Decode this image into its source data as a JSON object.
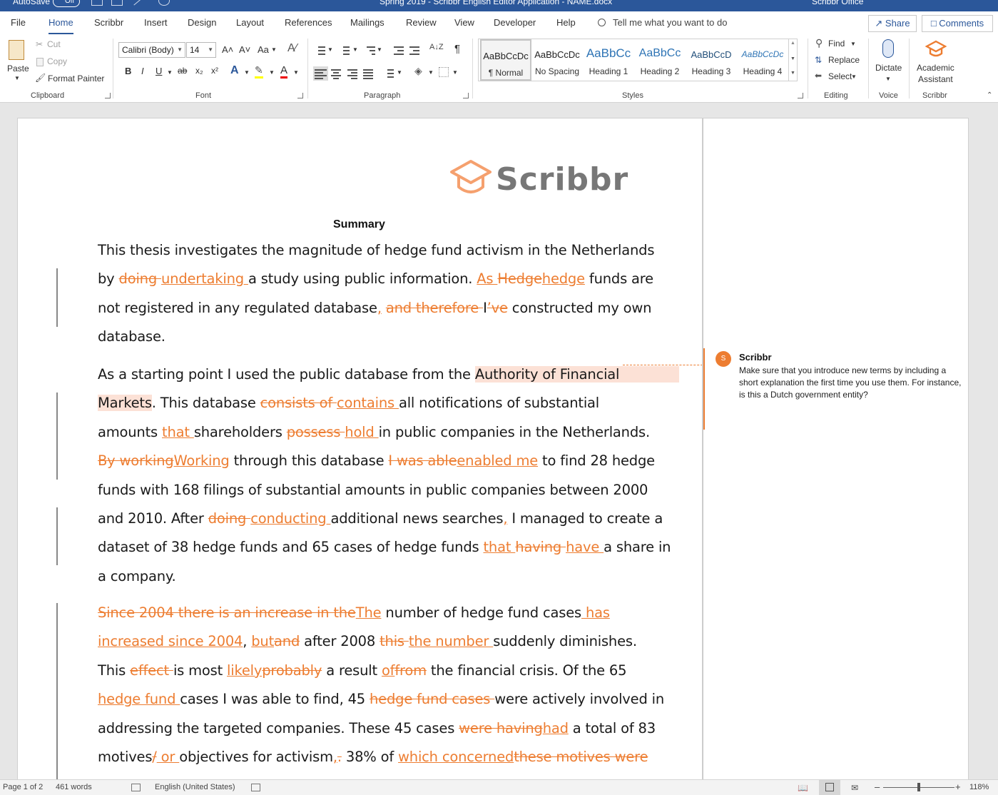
{
  "titlebar": {
    "autosave": "AutoSave",
    "autosave_state": "Off",
    "doc_title": "Spring 2019 - Scribbr English Editor Application - NAME.docx",
    "account": "Scribbr Office"
  },
  "tabs": [
    "File",
    "Home",
    "Scribbr",
    "Insert",
    "Design",
    "Layout",
    "References",
    "Mailings",
    "Review",
    "View",
    "Developer",
    "Help"
  ],
  "tellme": "Tell me what you want to do",
  "share": "Share",
  "comments": "Comments",
  "ribbon": {
    "clipboard": {
      "paste": "Paste",
      "cut": "Cut",
      "copy": "Copy",
      "format_painter": "Format Painter",
      "label": "Clipboard"
    },
    "font": {
      "name": "Calibri (Body)",
      "size": "14",
      "grow": "A˄",
      "shrink": "A˅",
      "case": "Aa",
      "bold": "B",
      "italic": "I",
      "underline": "U",
      "strike": "ab",
      "sub": "x₂",
      "sup": "x²",
      "label": "Font"
    },
    "paragraph": {
      "label": "Paragraph",
      "sort": "A↓Z",
      "pilcrow": "¶"
    },
    "styles": {
      "label": "Styles",
      "items": [
        {
          "sample": "AaBbCcDc",
          "name": "¶ Normal"
        },
        {
          "sample": "AaBbCcDc",
          "name": "No Spacing"
        },
        {
          "sample": "AaBbCc",
          "name": "Heading 1"
        },
        {
          "sample": "AaBbCc",
          "name": "Heading 2"
        },
        {
          "sample": "AaBbCcD",
          "name": "Heading 3"
        },
        {
          "sample": "AaBbCcDc",
          "name": "Heading 4"
        }
      ]
    },
    "editing": {
      "find": "Find",
      "replace": "Replace",
      "select": "Select",
      "label": "Editing"
    },
    "voice": {
      "dictate": "Dictate",
      "label": "Voice"
    },
    "scribbr": {
      "assistant_1": "Academic",
      "assistant_2": "Assistant",
      "label": "Scribbr"
    }
  },
  "document": {
    "logo_word": "Scribbr",
    "title": "Summary",
    "paragraphs": [
      [
        [
          [
            "t",
            "This thesis investigates the magnitude of hedge fund activism in the Netherlands"
          ]
        ],
        [
          [
            "t",
            "by "
          ],
          [
            "d",
            "doing "
          ],
          [
            "i",
            "undertaking "
          ],
          [
            "t",
            "a study using public information. "
          ],
          [
            "i",
            "As "
          ],
          [
            "d",
            "Hedge"
          ],
          [
            "i",
            "hedge"
          ],
          [
            "t",
            " funds are"
          ]
        ],
        [
          [
            "t",
            "not registered in any regulated database"
          ],
          [
            "i",
            ","
          ],
          [
            "t",
            " "
          ],
          [
            "d",
            "and therefore "
          ],
          [
            "t",
            "I"
          ],
          [
            "d",
            "’ve"
          ],
          [
            "t",
            " constructed my own"
          ]
        ],
        [
          [
            "t",
            "database."
          ]
        ]
      ],
      [
        [
          [
            "t",
            "As a starting point I used the public database from the "
          ],
          [
            "h",
            "Authority of Financial              "
          ]
        ],
        [
          [
            "h",
            "Markets"
          ],
          [
            "t",
            ". This database "
          ],
          [
            "d",
            "consists of "
          ],
          [
            "i",
            "contains "
          ],
          [
            "t",
            "all notifications of substantial"
          ]
        ],
        [
          [
            "t",
            "amounts "
          ],
          [
            "i",
            "that "
          ],
          [
            "t",
            "shareholders "
          ],
          [
            "d",
            "possess "
          ],
          [
            "i",
            "hold "
          ],
          [
            "t",
            "in public companies in the Netherlands."
          ]
        ],
        [
          [
            "d",
            "By working"
          ],
          [
            "i",
            "Working"
          ],
          [
            "t",
            " through this database "
          ],
          [
            "d",
            "I was able"
          ],
          [
            "i",
            "enabled me"
          ],
          [
            "t",
            " to find 28 hedge"
          ]
        ],
        [
          [
            "t",
            "funds with 168 filings of substantial amounts in public companies between 2000"
          ]
        ],
        [
          [
            "t",
            "and 2010. After "
          ],
          [
            "d",
            "doing "
          ],
          [
            "i",
            "conducting "
          ],
          [
            "t",
            "additional news searches"
          ],
          [
            "i",
            ","
          ],
          [
            "t",
            " I managed to create a"
          ]
        ],
        [
          [
            "t",
            "dataset of 38 hedge funds and 65 cases of hedge funds "
          ],
          [
            "i",
            "that "
          ],
          [
            "d",
            "having "
          ],
          [
            "i",
            "have "
          ],
          [
            "t",
            "a share in"
          ]
        ],
        [
          [
            "t",
            "a company."
          ]
        ]
      ],
      [
        [
          [
            "d",
            "Since 2004 there is an increase in the"
          ],
          [
            "i",
            "The"
          ],
          [
            "t",
            " number of hedge fund cases"
          ],
          [
            "i",
            " has"
          ]
        ],
        [
          [
            "i",
            "increased since 2004"
          ],
          [
            "t",
            ", "
          ],
          [
            "i",
            "but"
          ],
          [
            "d",
            "and"
          ],
          [
            "t",
            " after 2008 "
          ],
          [
            "d",
            "this "
          ],
          [
            "i",
            "the number "
          ],
          [
            "t",
            "suddenly diminishes."
          ]
        ],
        [
          [
            "t",
            "This "
          ],
          [
            "d",
            "effect "
          ],
          [
            "t",
            "is most "
          ],
          [
            "i",
            "likely"
          ],
          [
            "d",
            "probably"
          ],
          [
            "t",
            " a result "
          ],
          [
            "i",
            "of"
          ],
          [
            "d",
            "from"
          ],
          [
            "t",
            " the financial crisis. Of the 65"
          ]
        ],
        [
          [
            "i",
            "hedge fund "
          ],
          [
            "t",
            "cases I was able to find, 45 "
          ],
          [
            "d",
            "hedge fund cases "
          ],
          [
            "t",
            "were actively involved in"
          ]
        ],
        [
          [
            "t",
            "addressing the targeted companies. These 45 cases "
          ],
          [
            "d",
            "were having"
          ],
          [
            "i",
            "had"
          ],
          [
            "t",
            " a total of 83"
          ]
        ],
        [
          [
            "t",
            "motives"
          ],
          [
            "d",
            "/"
          ],
          [
            "i",
            " or "
          ],
          [
            "t",
            "objectives for activism"
          ],
          [
            "i",
            ","
          ],
          [
            "d",
            "."
          ],
          [
            "t",
            " 38% of "
          ],
          [
            "i",
            "which concerned"
          ],
          [
            "d",
            "these motives were"
          ]
        ]
      ]
    ]
  },
  "comment": {
    "avatar": "S",
    "author": "Scribbr",
    "text": "Make sure that you introduce new terms by including a short explanation the first time you use them. For instance, is this a Dutch government entity?"
  },
  "status": {
    "page": "Page 1 of 2",
    "words": "461 words",
    "language": "English (United States)",
    "zoom": "118%",
    "zoom_minus": "–",
    "zoom_plus": "+"
  },
  "colors": {
    "accent": "#2b579a",
    "track_change": "#ed7d31",
    "highlight": "#fce1d6"
  }
}
